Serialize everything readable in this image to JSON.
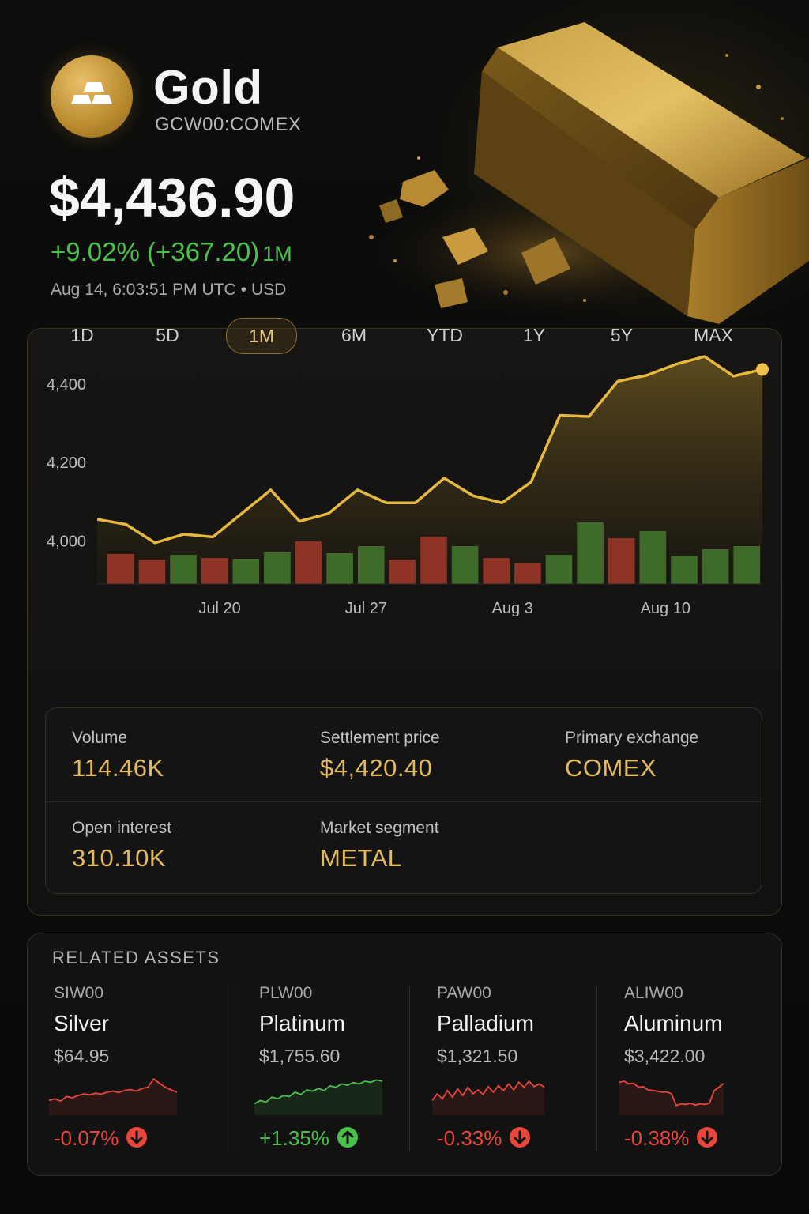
{
  "asset": {
    "name": "Gold",
    "ticker": "GCW00:COMEX",
    "price": "$4,436.90",
    "change": "+9.02% (+367.20)",
    "change_period": "1M",
    "timestamp": "Aug 14, 6:03:51 PM UTC",
    "currency": "USD",
    "logo_icon": "gold-bars-icon"
  },
  "chart_data": {
    "type": "line",
    "x_ticks": [
      "Jul 20",
      "Jul 27",
      "Aug 3",
      "Aug 10"
    ],
    "y_ticks": [
      "4,400",
      "4,200",
      "4,000"
    ],
    "ylim": [
      3890,
      4460
    ],
    "grid": false,
    "series": [
      {
        "values": [
          4055,
          4042,
          3995,
          4017,
          4010,
          4070,
          4130,
          4050,
          4070,
          4130,
          4097,
          4097,
          4160,
          4115,
          4097,
          4150,
          4320,
          4317,
          4407,
          4422,
          4450,
          4470,
          4420,
          4437
        ]
      }
    ],
    "volume_bars": [
      {
        "value": 38,
        "trend": "down"
      },
      {
        "value": 31,
        "trend": "down"
      },
      {
        "value": 37,
        "trend": "up"
      },
      {
        "value": 33,
        "trend": "down"
      },
      {
        "value": 32,
        "trend": "up"
      },
      {
        "value": 40,
        "trend": "up"
      },
      {
        "value": 54,
        "trend": "down"
      },
      {
        "value": 39,
        "trend": "up"
      },
      {
        "value": 48,
        "trend": "up"
      },
      {
        "value": 31,
        "trend": "down"
      },
      {
        "value": 60,
        "trend": "down"
      },
      {
        "value": 48,
        "trend": "up"
      },
      {
        "value": 33,
        "trend": "down"
      },
      {
        "value": 27,
        "trend": "down"
      },
      {
        "value": 37,
        "trend": "up"
      },
      {
        "value": 78,
        "trend": "up"
      },
      {
        "value": 58,
        "trend": "down"
      },
      {
        "value": 67,
        "trend": "up"
      },
      {
        "value": 36,
        "trend": "up"
      },
      {
        "value": 44,
        "trend": "up"
      },
      {
        "value": 48,
        "trend": "up"
      }
    ],
    "colors": {
      "line": "#e6b83f",
      "up": "#3f6b2a",
      "down": "#8e3325",
      "marker": "#f0c04a"
    }
  },
  "ranges": [
    {
      "label": "1D",
      "active": false
    },
    {
      "label": "5D",
      "active": false
    },
    {
      "label": "1M",
      "active": true
    },
    {
      "label": "6M",
      "active": false
    },
    {
      "label": "YTD",
      "active": false
    },
    {
      "label": "1Y",
      "active": false
    },
    {
      "label": "5Y",
      "active": false
    },
    {
      "label": "MAX",
      "active": false
    }
  ],
  "stats": {
    "volume_label": "Volume",
    "volume_value": "114.46K",
    "settlement_label": "Settlement price",
    "settlement_value": "$4,420.40",
    "exchange_label": "Primary exchange",
    "exchange_value": "COMEX",
    "open_interest_label": "Open interest",
    "open_interest_value": "310.10K",
    "segment_label": "Market segment",
    "segment_value": "METAL"
  },
  "related": {
    "title": "RELATED ASSETS",
    "items": [
      {
        "symbol": "SIW00",
        "name": "Silver",
        "price": "$64.95",
        "change": "-0.07%",
        "direction": "down",
        "spark": [
          0.3,
          0.35,
          0.28,
          0.42,
          0.38,
          0.45,
          0.5,
          0.47,
          0.52,
          0.49,
          0.55,
          0.58,
          0.54,
          0.6,
          0.63,
          0.58,
          0.66,
          0.7,
          0.95,
          0.82,
          0.7,
          0.62,
          0.55
        ]
      },
      {
        "symbol": "PLW00",
        "name": "Platinum",
        "price": "$1,755.60",
        "change": "+1.35%",
        "direction": "up",
        "spark": [
          0.2,
          0.3,
          0.25,
          0.4,
          0.35,
          0.45,
          0.42,
          0.55,
          0.48,
          0.62,
          0.58,
          0.66,
          0.6,
          0.74,
          0.7,
          0.8,
          0.76,
          0.84,
          0.8,
          0.88,
          0.85,
          0.92,
          0.88
        ]
      },
      {
        "symbol": "PAW00",
        "name": "Palladium",
        "price": "$1,321.50",
        "change": "-0.33%",
        "direction": "down",
        "spark": [
          0.3,
          0.5,
          0.35,
          0.6,
          0.4,
          0.65,
          0.45,
          0.7,
          0.5,
          0.62,
          0.48,
          0.72,
          0.55,
          0.75,
          0.6,
          0.8,
          0.62,
          0.85,
          0.7,
          0.88,
          0.72,
          0.8,
          0.7
        ]
      },
      {
        "symbol": "ALIW00",
        "name": "Aluminum",
        "price": "$3,422.00",
        "change": "-0.38%",
        "direction": "down",
        "spark": [
          0.85,
          0.88,
          0.8,
          0.82,
          0.7,
          0.72,
          0.62,
          0.6,
          0.58,
          0.55,
          0.56,
          0.5,
          0.15,
          0.2,
          0.18,
          0.22,
          0.16,
          0.2,
          0.18,
          0.22,
          0.6,
          0.7,
          0.82
        ]
      }
    ]
  },
  "colors": {
    "gold": "#e3ba5d",
    "up": "#49c24a",
    "down": "#e8463a"
  }
}
